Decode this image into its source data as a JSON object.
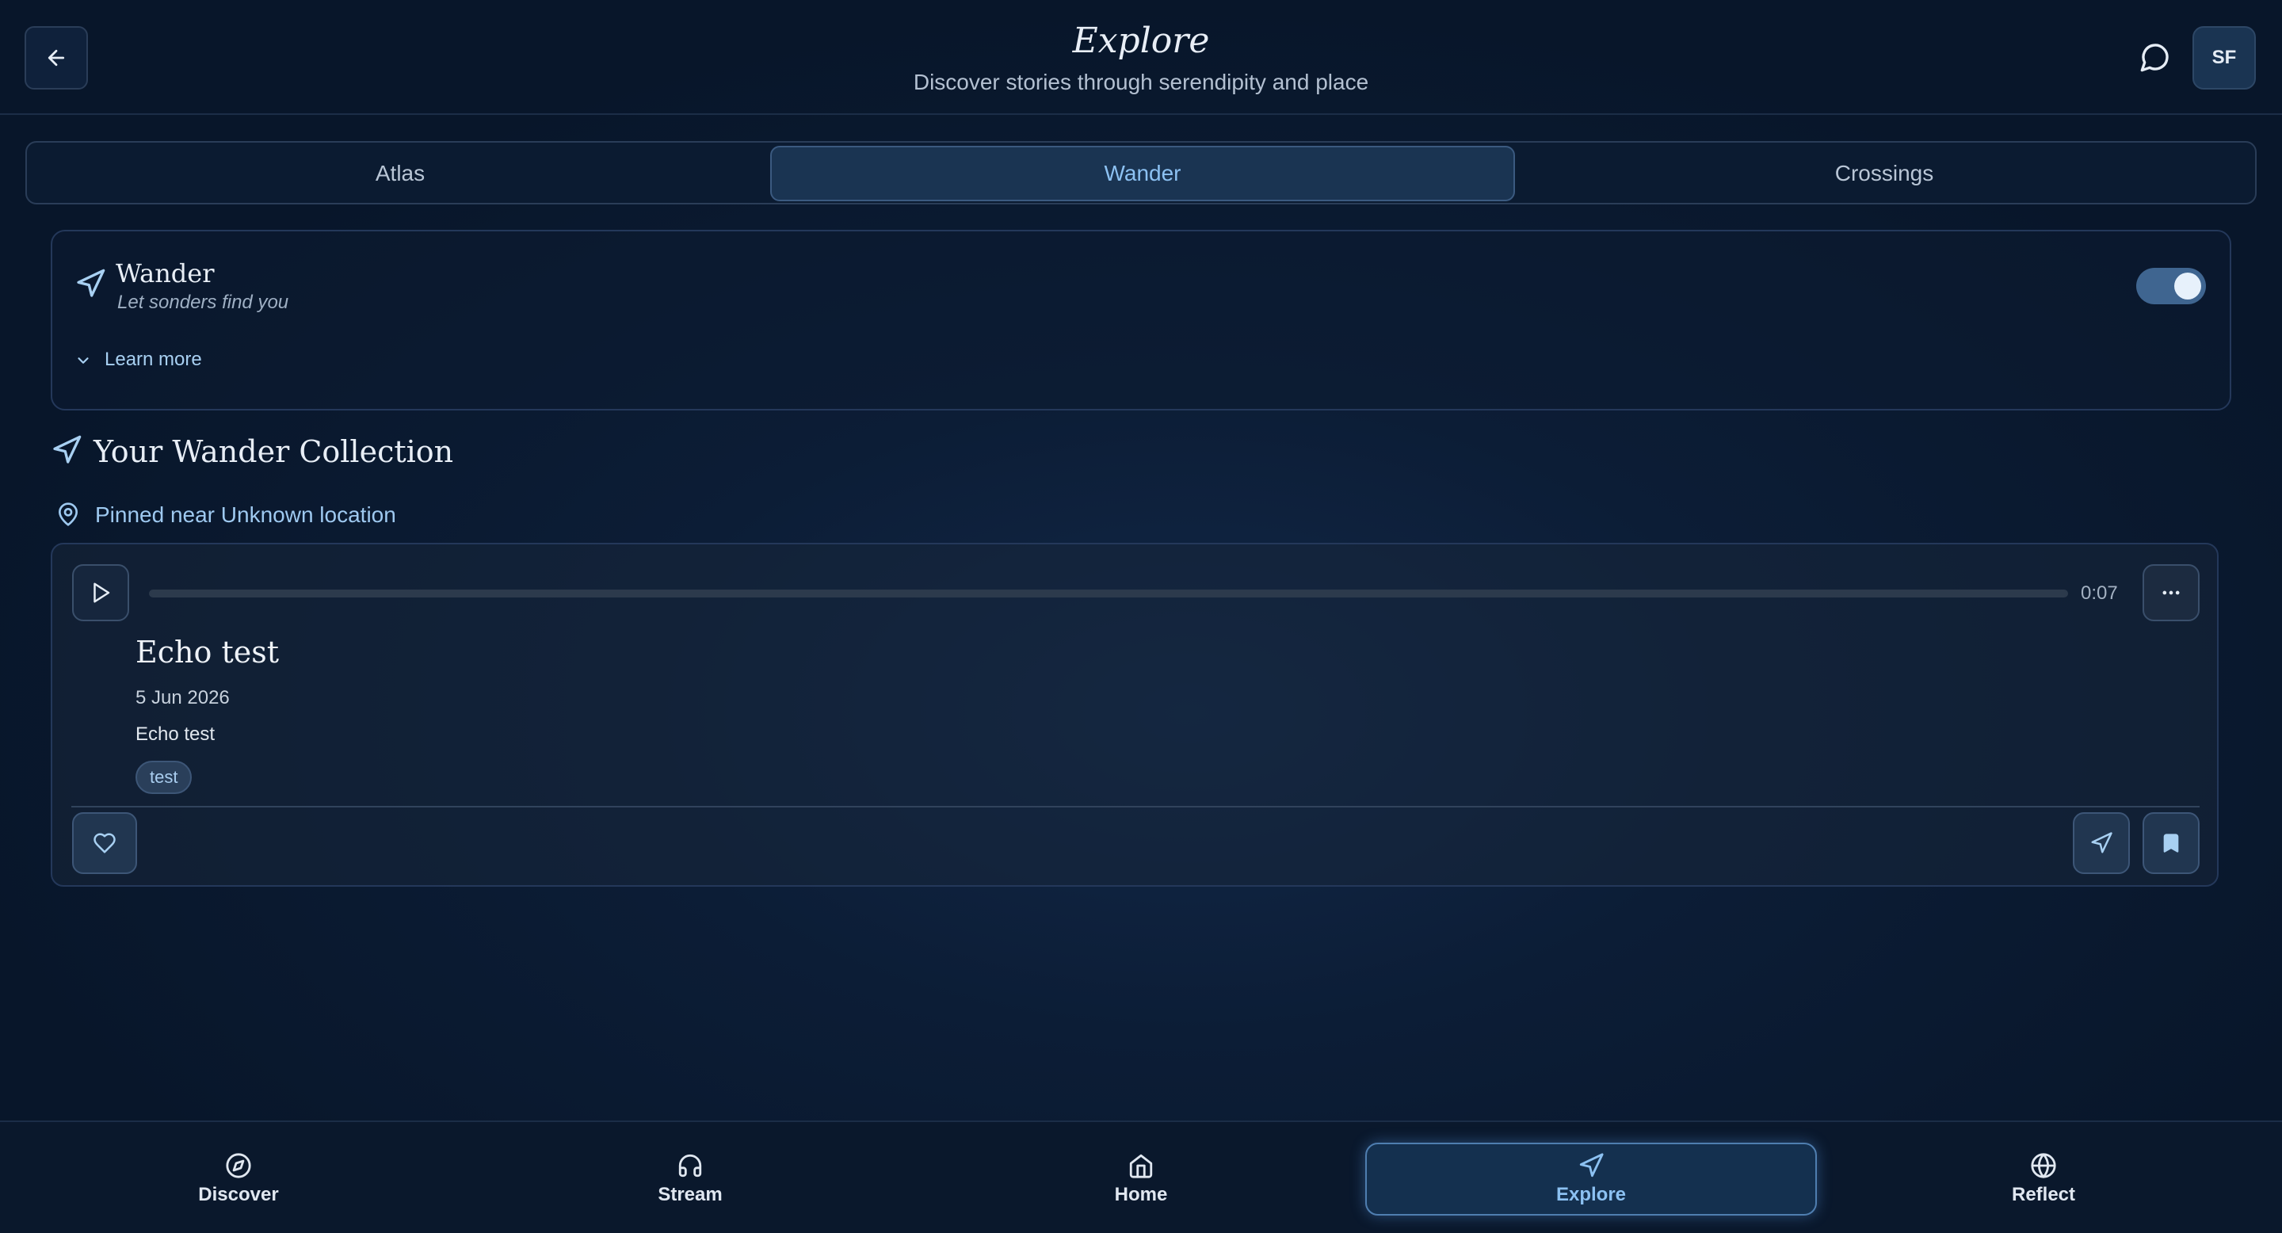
{
  "header": {
    "title": "Explore",
    "subtitle": "Discover stories through serendipity and place",
    "avatar_initials": "SF"
  },
  "tabs": [
    {
      "label": "Atlas",
      "active": false
    },
    {
      "label": "Wander",
      "active": true
    },
    {
      "label": "Crossings",
      "active": false
    }
  ],
  "wander": {
    "title": "Wander",
    "subtitle": "Let sonders find you",
    "toggle_on": true,
    "learn_more": "Learn more"
  },
  "collection": {
    "title": "Your Wander Collection",
    "location": "Pinned near Unknown location"
  },
  "echo": {
    "duration": "0:07",
    "progress": 0,
    "title": "Echo test",
    "date": "5 Jun 2026",
    "description": "Echo test",
    "tag": "test"
  },
  "bottom_nav": [
    {
      "label": "Discover",
      "icon": "compass-icon"
    },
    {
      "label": "Stream",
      "icon": "headphones-icon"
    },
    {
      "label": "Home",
      "icon": "home-icon"
    },
    {
      "label": "Explore",
      "icon": "navigation-icon",
      "active": true
    },
    {
      "label": "Reflect",
      "icon": "globe-icon"
    }
  ],
  "colors": {
    "accent": "#8cc1f2",
    "background": "#0c1d36",
    "toggle": "#3f6590"
  }
}
